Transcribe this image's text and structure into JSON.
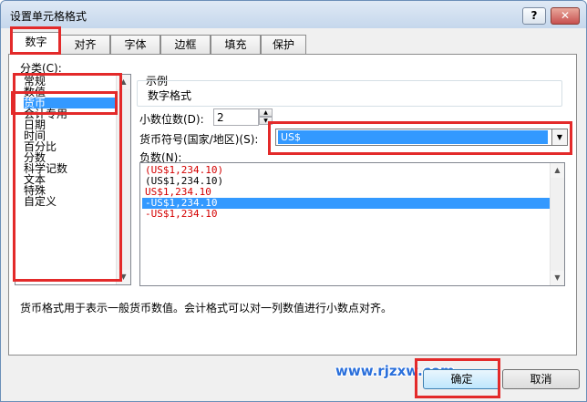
{
  "window": {
    "title": "设置单元格格式",
    "help_label": "?",
    "close_label": "✕"
  },
  "tabs": [
    {
      "label": "数字",
      "active": true
    },
    {
      "label": "对齐",
      "active": false
    },
    {
      "label": "字体",
      "active": false
    },
    {
      "label": "边框",
      "active": false
    },
    {
      "label": "填充",
      "active": false
    },
    {
      "label": "保护",
      "active": false
    }
  ],
  "category": {
    "label": "分类(C):",
    "items": [
      "常规",
      "数值",
      "货币",
      "会计专用",
      "日期",
      "时间",
      "百分比",
      "分数",
      "科学记数",
      "文本",
      "特殊",
      "自定义"
    ],
    "selected_index": 2
  },
  "sample": {
    "label": "示例",
    "value": "数字格式"
  },
  "decimal": {
    "label": "小数位数(D):",
    "value": "2"
  },
  "currency": {
    "label": "货币符号(国家/地区)(S):",
    "value": "US$"
  },
  "negative": {
    "label": "负数(N):",
    "items": [
      {
        "text": "(US$1,234.10)",
        "color": "#d40000"
      },
      {
        "text": "(US$1,234.10)",
        "color": "#000000"
      },
      {
        "text": "US$1,234.10",
        "color": "#d40000"
      },
      {
        "text": "-US$1,234.10",
        "color": "#ffffff"
      },
      {
        "text": "-US$1,234.10",
        "color": "#d40000"
      }
    ],
    "selected_index": 3
  },
  "description": "货币格式用于表示一般货币数值。会计格式可以对一列数值进行小数点对齐。",
  "buttons": {
    "ok": "确定",
    "cancel": "取消"
  },
  "watermark": "www.rjzxw.com",
  "colors": {
    "selection": "#3399ff",
    "annotation_red": "#e32a2a",
    "negative_red": "#d40000"
  }
}
